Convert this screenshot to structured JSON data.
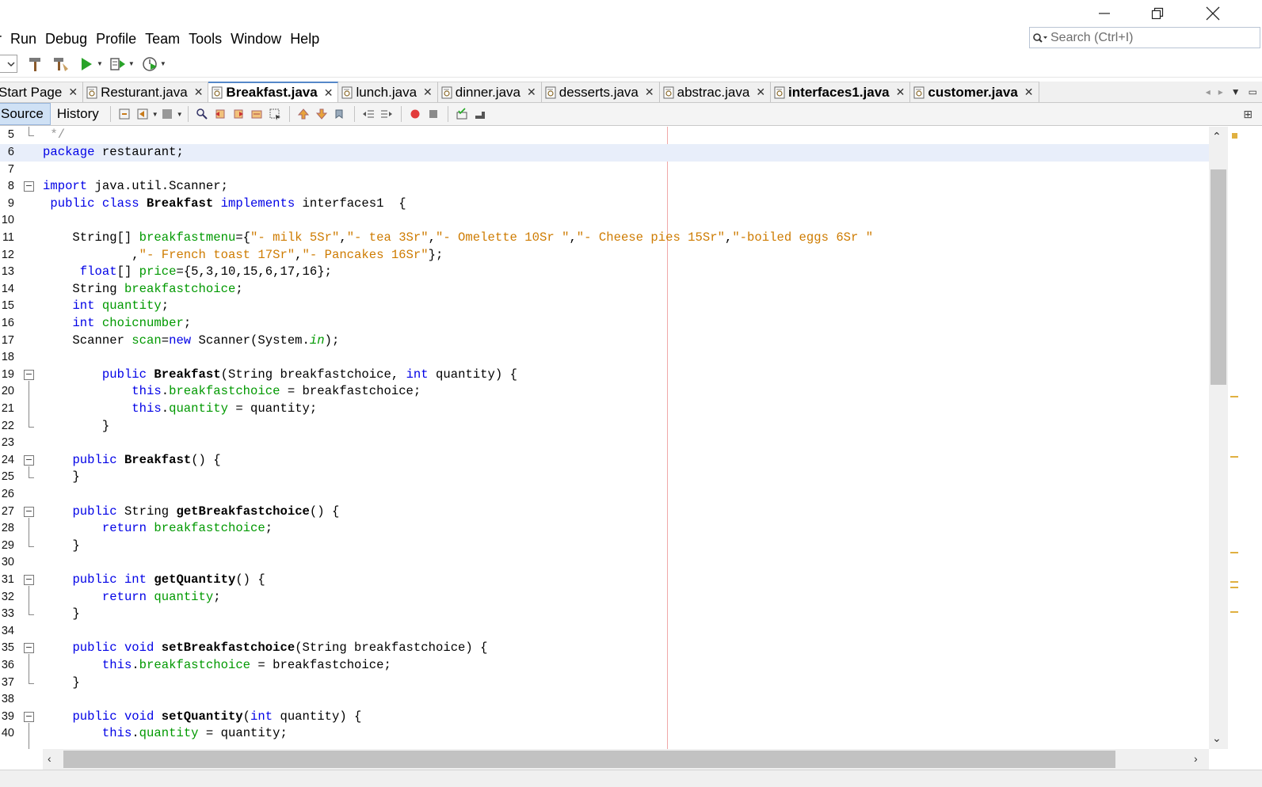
{
  "menu": [
    "r",
    "Run",
    "Debug",
    "Profile",
    "Team",
    "Tools",
    "Window",
    "Help"
  ],
  "search": {
    "placeholder": "Search (Ctrl+I)"
  },
  "tabs": [
    {
      "label": "Start Page",
      "active": false,
      "bold": false
    },
    {
      "label": "Resturant.java",
      "active": false,
      "bold": false
    },
    {
      "label": "Breakfast.java",
      "active": true,
      "bold": true
    },
    {
      "label": "lunch.java",
      "active": false,
      "bold": false
    },
    {
      "label": "dinner.java",
      "active": false,
      "bold": false
    },
    {
      "label": "desserts.java",
      "active": false,
      "bold": false
    },
    {
      "label": "abstrac.java",
      "active": false,
      "bold": false
    },
    {
      "label": "interfaces1.java",
      "active": false,
      "bold": true
    },
    {
      "label": "customer.java",
      "active": false,
      "bold": true
    }
  ],
  "editor_tabs": {
    "source": "Source",
    "history": "History"
  },
  "code": {
    "first_line": 5,
    "current_line": 6,
    "lines": [
      [
        [
          "cmt",
          " */"
        ]
      ],
      [
        [
          "kw",
          "package"
        ],
        [
          "",
          " restaurant;"
        ]
      ],
      [],
      [
        [
          "kw",
          "import"
        ],
        [
          "",
          " java.util.Scanner;"
        ]
      ],
      [
        [
          "",
          " "
        ],
        [
          "kw",
          "public class"
        ],
        [
          "",
          " "
        ],
        [
          "bold",
          "Breakfast"
        ],
        [
          "",
          " "
        ],
        [
          "kw",
          "implements"
        ],
        [
          "",
          " interfaces1  {"
        ]
      ],
      [],
      [
        [
          "",
          "    String[] "
        ],
        [
          "fld",
          "breakfastmenu"
        ],
        [
          "",
          "={"
        ],
        [
          "str",
          "\"- milk 5Sr\""
        ],
        [
          "",
          ","
        ],
        [
          "str",
          "\"- tea 3Sr\""
        ],
        [
          "",
          ","
        ],
        [
          "str",
          "\"- Omelette 10Sr \""
        ],
        [
          "",
          ","
        ],
        [
          "str",
          "\"- Cheese pies 15Sr\""
        ],
        [
          "",
          ","
        ],
        [
          "str",
          "\"-boiled eggs 6Sr \""
        ]
      ],
      [
        [
          "",
          "            ,"
        ],
        [
          "str",
          "\"- French toast 17Sr\""
        ],
        [
          "",
          ","
        ],
        [
          "str",
          "\"- Pancakes 16Sr\""
        ],
        [
          "",
          "};"
        ]
      ],
      [
        [
          "",
          "     "
        ],
        [
          "kw",
          "float"
        ],
        [
          "",
          "[] "
        ],
        [
          "fld",
          "price"
        ],
        [
          "",
          "={5,3,10,15,6,17,16};"
        ]
      ],
      [
        [
          "",
          "    String "
        ],
        [
          "fld",
          "breakfastchoice"
        ],
        [
          "",
          ";"
        ]
      ],
      [
        [
          "",
          "    "
        ],
        [
          "kw",
          "int"
        ],
        [
          "",
          " "
        ],
        [
          "fld",
          "quantity"
        ],
        [
          "",
          ";"
        ]
      ],
      [
        [
          "",
          "    "
        ],
        [
          "kw",
          "int"
        ],
        [
          "",
          " "
        ],
        [
          "fld",
          "choicnumber"
        ],
        [
          "",
          ";"
        ]
      ],
      [
        [
          "",
          "    Scanner "
        ],
        [
          "fld",
          "scan"
        ],
        [
          "",
          "="
        ],
        [
          "kw",
          "new"
        ],
        [
          "",
          " Scanner(System."
        ],
        [
          "fld it",
          "in"
        ],
        [
          "",
          ");"
        ]
      ],
      [],
      [
        [
          "",
          "        "
        ],
        [
          "kw",
          "public"
        ],
        [
          "",
          " "
        ],
        [
          "bold",
          "Breakfast"
        ],
        [
          "",
          "(String breakfastchoice, "
        ],
        [
          "kw",
          "int"
        ],
        [
          "",
          " quantity) {"
        ]
      ],
      [
        [
          "",
          "            "
        ],
        [
          "kw",
          "this"
        ],
        [
          "",
          "."
        ],
        [
          "fld",
          "breakfastchoice"
        ],
        [
          "",
          " = breakfastchoice;"
        ]
      ],
      [
        [
          "",
          "            "
        ],
        [
          "kw",
          "this"
        ],
        [
          "",
          "."
        ],
        [
          "fld",
          "quantity"
        ],
        [
          "",
          " = quantity;"
        ]
      ],
      [
        [
          "",
          "        }"
        ]
      ],
      [],
      [
        [
          "",
          "    "
        ],
        [
          "kw",
          "public"
        ],
        [
          "",
          " "
        ],
        [
          "bold",
          "Breakfast"
        ],
        [
          "",
          "() {"
        ]
      ],
      [
        [
          "",
          "    }"
        ]
      ],
      [],
      [
        [
          "",
          "    "
        ],
        [
          "kw",
          "public"
        ],
        [
          "",
          " String "
        ],
        [
          "bold",
          "getBreakfastchoice"
        ],
        [
          "",
          "() {"
        ]
      ],
      [
        [
          "",
          "        "
        ],
        [
          "kw",
          "return"
        ],
        [
          "",
          " "
        ],
        [
          "fld",
          "breakfastchoice"
        ],
        [
          "",
          ";"
        ]
      ],
      [
        [
          "",
          "    }"
        ]
      ],
      [],
      [
        [
          "",
          "    "
        ],
        [
          "kw",
          "public int"
        ],
        [
          "",
          " "
        ],
        [
          "bold",
          "getQuantity"
        ],
        [
          "",
          "() {"
        ]
      ],
      [
        [
          "",
          "        "
        ],
        [
          "kw",
          "return"
        ],
        [
          "",
          " "
        ],
        [
          "fld",
          "quantity"
        ],
        [
          "",
          ";"
        ]
      ],
      [
        [
          "",
          "    }"
        ]
      ],
      [],
      [
        [
          "",
          "    "
        ],
        [
          "kw",
          "public void"
        ],
        [
          "",
          " "
        ],
        [
          "bold",
          "setBreakfastchoice"
        ],
        [
          "",
          "(String breakfastchoice) {"
        ]
      ],
      [
        [
          "",
          "        "
        ],
        [
          "kw",
          "this"
        ],
        [
          "",
          "."
        ],
        [
          "fld",
          "breakfastchoice"
        ],
        [
          "",
          " = breakfastchoice;"
        ]
      ],
      [
        [
          "",
          "    }"
        ]
      ],
      [],
      [
        [
          "",
          "    "
        ],
        [
          "kw",
          "public void"
        ],
        [
          "",
          " "
        ],
        [
          "bold",
          "setQuantity"
        ],
        [
          "",
          "("
        ],
        [
          "kw",
          "int"
        ],
        [
          "",
          " quantity) {"
        ]
      ],
      [
        [
          "",
          "        "
        ],
        [
          "kw",
          "this"
        ],
        [
          "",
          "."
        ],
        [
          "fld",
          "quantity"
        ],
        [
          "",
          " = quantity;"
        ]
      ]
    ]
  },
  "colors": {
    "keyword": "#0000e6",
    "string": "#ce7b00",
    "field": "#009900",
    "comment": "#969696",
    "current_line": "#e8eefa",
    "active_tab_accent": "#5588c8"
  }
}
